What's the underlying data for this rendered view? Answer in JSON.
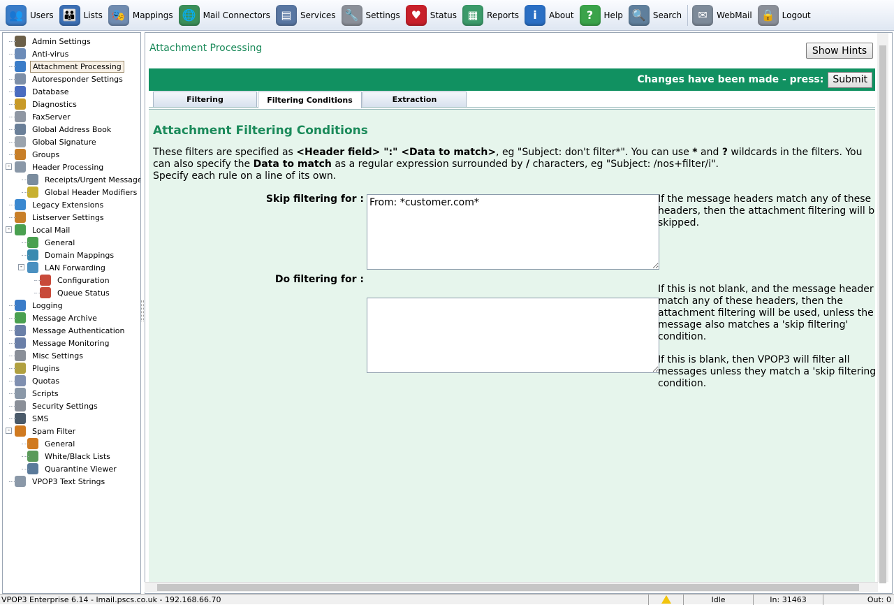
{
  "toolbar": [
    {
      "label": "Users",
      "icon": "users-icon",
      "color": "#3a7cc8",
      "glyph": "👥"
    },
    {
      "label": "Lists",
      "icon": "lists-icon",
      "color": "#3b6fb4",
      "glyph": "👪"
    },
    {
      "label": "Mappings",
      "icon": "mappings-icon",
      "color": "#6f8bb0",
      "glyph": "🎭"
    },
    {
      "label": "Mail Connectors",
      "icon": "mail-connectors-icon",
      "color": "#3b8f5a",
      "glyph": "🌐"
    },
    {
      "label": "Services",
      "icon": "services-icon",
      "color": "#5876a2",
      "glyph": "▤"
    },
    {
      "label": "Settings",
      "icon": "settings-icon",
      "color": "#8a8f98",
      "glyph": "🔧"
    },
    {
      "label": "Status",
      "icon": "status-icon",
      "color": "#c8202a",
      "glyph": "♥"
    },
    {
      "label": "Reports",
      "icon": "reports-icon",
      "color": "#3b9a6a",
      "glyph": "▦"
    },
    {
      "label": "About",
      "icon": "about-icon",
      "color": "#2a6fc4",
      "glyph": "i"
    },
    {
      "label": "Help",
      "icon": "help-icon",
      "color": "#3aa34a",
      "glyph": "?"
    },
    {
      "label": "Search",
      "icon": "search-icon",
      "color": "#5f7f9c",
      "glyph": "🔍"
    },
    {
      "label": "WebMail",
      "icon": "webmail-icon",
      "color": "#7d8a99",
      "glyph": "✉"
    },
    {
      "label": "Logout",
      "icon": "logout-icon",
      "color": "#8a8f98",
      "glyph": "🔒"
    }
  ],
  "sidebar": [
    {
      "label": "Admin Settings",
      "icon": "admin-settings-icon",
      "color": "#6b5f48",
      "level": 0
    },
    {
      "label": "Anti-virus",
      "icon": "anti-virus-icon",
      "color": "#6c8cb8",
      "level": 0
    },
    {
      "label": "Attachment Processing",
      "icon": "attachment-icon",
      "color": "#3a7cc8",
      "level": 0,
      "selected": true
    },
    {
      "label": "Autoresponder Settings",
      "icon": "autoresponder-icon",
      "color": "#7d8fa8",
      "level": 0
    },
    {
      "label": "Database",
      "icon": "database-icon",
      "color": "#4a6cc0",
      "level": 0
    },
    {
      "label": "Diagnostics",
      "icon": "diagnostics-icon",
      "color": "#c89a28",
      "level": 0
    },
    {
      "label": "FaxServer",
      "icon": "faxserver-icon",
      "color": "#8f97a3",
      "level": 0
    },
    {
      "label": "Global Address Book",
      "icon": "address-book-icon",
      "color": "#6a7f98",
      "level": 0
    },
    {
      "label": "Global Signature",
      "icon": "signature-icon",
      "color": "#9aa3ad",
      "level": 0
    },
    {
      "label": "Groups",
      "icon": "groups-icon",
      "color": "#c87f28",
      "level": 0
    },
    {
      "label": "Header Processing",
      "icon": "header-processing-icon",
      "color": "#8a98a8",
      "level": 0,
      "expander": "-"
    },
    {
      "label": "Receipts/Urgent Messages",
      "icon": "receipts-icon",
      "color": "#7a8c9e",
      "level": 1
    },
    {
      "label": "Global Header Modifiers",
      "icon": "header-modifiers-icon",
      "color": "#c8b030",
      "level": 1
    },
    {
      "label": "Legacy Extensions",
      "icon": "legacy-extensions-icon",
      "color": "#3a88d0",
      "level": 0
    },
    {
      "label": "Listserver Settings",
      "icon": "listserver-icon",
      "color": "#c87f28",
      "level": 0
    },
    {
      "label": "Local Mail",
      "icon": "local-mail-icon",
      "color": "#4aa050",
      "level": 0,
      "expander": "-"
    },
    {
      "label": "General",
      "icon": "general-icon",
      "color": "#4aa050",
      "level": 1
    },
    {
      "label": "Domain Mappings",
      "icon": "domain-mappings-icon",
      "color": "#3a8ab0",
      "level": 1
    },
    {
      "label": "LAN Forwarding",
      "icon": "lan-forwarding-icon",
      "color": "#4a90c0",
      "level": 1,
      "expander": "-"
    },
    {
      "label": "Configuration",
      "icon": "configuration-icon",
      "color": "#c84a3a",
      "level": 2
    },
    {
      "label": "Queue Status",
      "icon": "queue-status-icon",
      "color": "#c84a3a",
      "level": 2
    },
    {
      "label": "Logging",
      "icon": "logging-icon",
      "color": "#3a7cc8",
      "level": 0
    },
    {
      "label": "Message Archive",
      "icon": "message-archive-icon",
      "color": "#4aa050",
      "level": 0
    },
    {
      "label": "Message Authentication",
      "icon": "message-auth-icon",
      "color": "#6a7fa8",
      "level": 0
    },
    {
      "label": "Message Monitoring",
      "icon": "message-monitoring-icon",
      "color": "#6a7fa8",
      "level": 0
    },
    {
      "label": "Misc Settings",
      "icon": "misc-settings-icon",
      "color": "#8a8f98",
      "level": 0
    },
    {
      "label": "Plugins",
      "icon": "plugins-icon",
      "color": "#b0a040",
      "level": 0
    },
    {
      "label": "Quotas",
      "icon": "quotas-icon",
      "color": "#7f8fb0",
      "level": 0
    },
    {
      "label": "Scripts",
      "icon": "scripts-icon",
      "color": "#8a98a8",
      "level": 0
    },
    {
      "label": "Security Settings",
      "icon": "security-icon",
      "color": "#8a8f98",
      "level": 0
    },
    {
      "label": "SMS",
      "icon": "sms-icon",
      "color": "#4a5a6a",
      "level": 0
    },
    {
      "label": "Spam Filter",
      "icon": "spam-filter-icon",
      "color": "#d07a20",
      "level": 0,
      "expander": "-"
    },
    {
      "label": "General",
      "icon": "spam-general-icon",
      "color": "#d07a20",
      "level": 1
    },
    {
      "label": "White/Black Lists",
      "icon": "white-black-lists-icon",
      "color": "#5a9a5a",
      "level": 1
    },
    {
      "label": "Quarantine Viewer",
      "icon": "quarantine-viewer-icon",
      "color": "#5a7a9a",
      "level": 1
    },
    {
      "label": "VPOP3 Text Strings",
      "icon": "text-strings-icon",
      "color": "#8a98a8",
      "level": 0
    }
  ],
  "main": {
    "page_title": "Attachment Processing",
    "show_hints": "Show Hints",
    "changes_msg": "Changes have been made - press:",
    "submit": "Submit",
    "tabs": [
      "Filtering",
      "Filtering Conditions",
      "Extraction"
    ],
    "active_tab": 1,
    "section_title": "Attachment Filtering Conditions",
    "intro_html": "These filters are specified as <b>&lt;Header field&gt; \":\" &lt;Data to match&gt;</b>, eg \"Subject: don't filter*\". You can use <b>*</b> and <b>?</b> wildcards in the filters. You can also specify the <b>Data to match</b> as a regular expression surrounded by <b>/</b> characters, eg \"Subject: /nos+filter/i\".<br>Specify each rule on a line of its own.",
    "skip_label": "Skip filtering for :",
    "skip_value": "From: *customer.com*",
    "skip_help": "If the message headers match any of these headers, then the attachment filtering will be skipped.",
    "do_label": "Do filtering for :",
    "do_value": "",
    "do_help1": "If this is not blank, and the message header match any of these headers, then the attachment filtering will be used, unless the message also matches a 'skip filtering' condition.",
    "do_help2": "If this is blank, then VPOP3 will filter all messages unless they match a 'skip filtering' condition."
  },
  "statusbar": {
    "server": "VPOP3 Enterprise 6.14 - lmail.pscs.co.uk - 192.168.66.70",
    "state": "Idle",
    "in": "In: 31463",
    "out": "Out: 0"
  }
}
